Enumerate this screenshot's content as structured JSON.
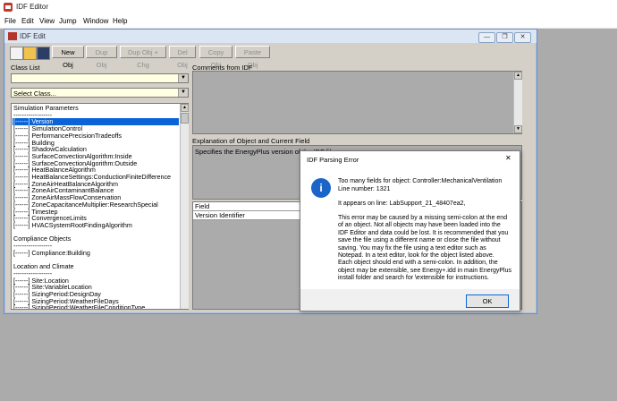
{
  "app": {
    "title": "IDF Editor"
  },
  "menu": [
    "File",
    "Edit",
    "View",
    "Jump",
    "Window",
    "Help"
  ],
  "child": {
    "title": "IDF Edit",
    "win_buttons": [
      "—",
      "❐",
      "✕"
    ],
    "toolbar": {
      "new_obj": "New Obj",
      "dup_obj": "Dup Obj",
      "dup_obj_chg": "Dup Obj + Chg",
      "del_obj": "Del Obj",
      "copy_obj": "Copy Obj",
      "paste_obj": "Paste Obj"
    },
    "class_list_label": "Class List",
    "comments_label": "Comments from IDF",
    "select_class": "Select Class...",
    "explanation_label": "Explanation of Object and Current Field",
    "explanation_text": "Specifies the EnergyPlus version of the IDF file.",
    "field_header": "Field",
    "field_row": "Version Identifier",
    "class_list": [
      {
        "text": "Simulation Parameters",
        "sel": false
      },
      {
        "text": "------------------",
        "sel": false
      },
      {
        "text": "[------]  Version",
        "sel": true
      },
      {
        "text": "[------]  SimulationControl",
        "sel": false
      },
      {
        "text": "[------]  PerformancePrecisionTradeoffs",
        "sel": false
      },
      {
        "text": "[------]  Building",
        "sel": false
      },
      {
        "text": "[------]  ShadowCalculation",
        "sel": false
      },
      {
        "text": "[------]  SurfaceConvectionAlgorithm:Inside",
        "sel": false
      },
      {
        "text": "[------]  SurfaceConvectionAlgorithm:Outside",
        "sel": false
      },
      {
        "text": "[------]  HeatBalanceAlgorithm",
        "sel": false
      },
      {
        "text": "[------]  HeatBalanceSettings:ConductionFiniteDifference",
        "sel": false
      },
      {
        "text": "[------]  ZoneAirHeatBalanceAlgorithm",
        "sel": false
      },
      {
        "text": "[------]  ZoneAirContaminantBalance",
        "sel": false
      },
      {
        "text": "[------]  ZoneAirMassFlowConservation",
        "sel": false
      },
      {
        "text": "[------]  ZoneCapacitanceMultiplier:ResearchSpecial",
        "sel": false
      },
      {
        "text": "[------]  Timestep",
        "sel": false
      },
      {
        "text": "[------]  ConvergenceLimits",
        "sel": false
      },
      {
        "text": "[------]  HVACSystemRootFindingAlgorithm",
        "sel": false
      },
      {
        "text": "",
        "sel": false
      },
      {
        "text": "Compliance Objects",
        "sel": false
      },
      {
        "text": "------------------",
        "sel": false
      },
      {
        "text": "[------]  Compliance:Building",
        "sel": false
      },
      {
        "text": "",
        "sel": false
      },
      {
        "text": "Location and Climate",
        "sel": false
      },
      {
        "text": "------------------",
        "sel": false
      },
      {
        "text": "[------]  Site:Location",
        "sel": false
      },
      {
        "text": "[------]  Site:VariableLocation",
        "sel": false
      },
      {
        "text": "[------]  SizingPeriod:DesignDay",
        "sel": false
      },
      {
        "text": "[------]  SizingPeriod:WeatherFileDays",
        "sel": false
      },
      {
        "text": "[------]  SizingPeriod:WeatherFileConditionType",
        "sel": false
      }
    ]
  },
  "dialog": {
    "title": "IDF Parsing Error",
    "close": "✕",
    "line1": "Too many fields for object: Controller:MechanicalVentilation",
    "line2": "Line number: 1321",
    "line3": "It appears on line: LabSupport_21_48407ea2,",
    "para": [
      "This error may be caused by a missing semi-colon at the end",
      "of an object. Not all objects may have been loaded into the",
      "IDF Editor and data could be lost. It is recommended that you",
      "save the file using a different name or close the file without",
      "saving.  You may fix the file using a text editor such as",
      "Notepad. In a text editor, look for the object listed above.",
      "Each object should end with a semi-colon. In addition, the",
      "object may be extensible, see Energy+.idd in main EnergyPlus",
      "install folder and search for \\extensible for instructions."
    ],
    "ok": "OK"
  }
}
